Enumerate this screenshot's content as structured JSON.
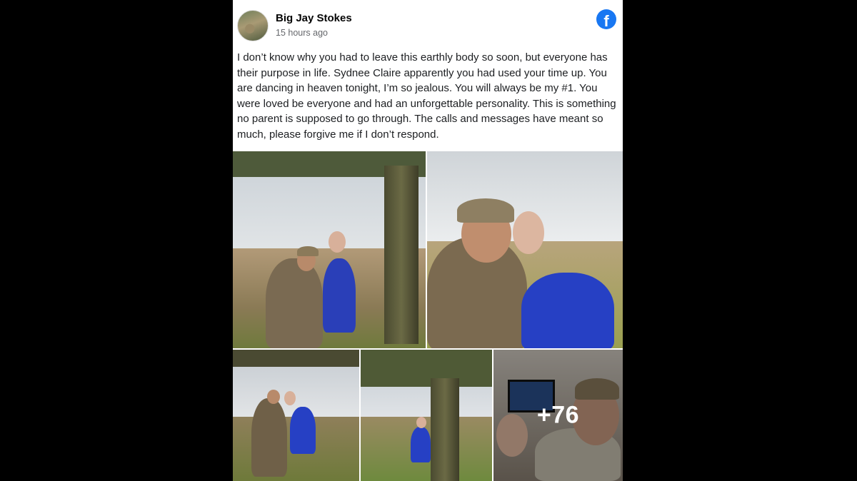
{
  "post": {
    "author": "Big Jay Stokes",
    "timestamp": "15 hours ago",
    "platform_icon": "facebook-icon",
    "brand_color": "#1877f2",
    "caption": "I don’t know why you had to leave this earthly body so soon, but everyone has their purpose in life. Sydnee Claire apparently you had used your time up. You are dancing in heaven tonight, I’m so jealous. You will always be my #1. You were loved be everyone and had an unforgettable personality. This is something no parent is supposed to go through. The calls and messages have meant so much, please forgive me if I don’t respond."
  },
  "gallery": {
    "more_count": "+76"
  }
}
